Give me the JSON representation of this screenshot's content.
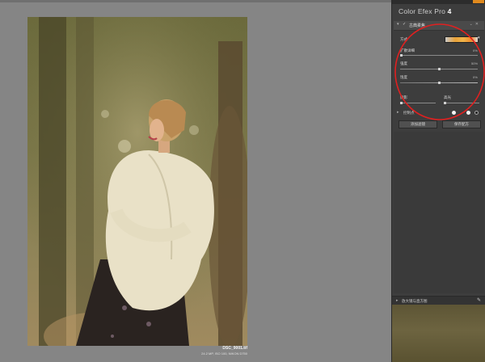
{
  "photo": {
    "file_name": "DSC_9001.tif",
    "meta": "24.2 MP, ISO 100, NIKON D750"
  },
  "panel": {
    "app_title": "Color Efex Pro",
    "app_version": "4",
    "filter": {
      "name": "古典柔焦",
      "method_label": "方式",
      "diffuse_label": "扩散详细",
      "diffuse_value": "0%",
      "diffuse_level": 0,
      "strength_label": "强度",
      "strength_value": "50%",
      "strength_level": 50,
      "saturation_label": "饱度",
      "saturation_value": "0%",
      "saturation_level": 0,
      "shadows_label": "阴影",
      "highlights_label": "高光"
    },
    "control_points_label": "控制点",
    "add_filter_button": "添加滤镜",
    "save_preset_button": "保存配方",
    "loupe_label": "放大镜与直方图"
  },
  "colors": {
    "annotation": "#e02020",
    "accent": "#e08a1e"
  }
}
